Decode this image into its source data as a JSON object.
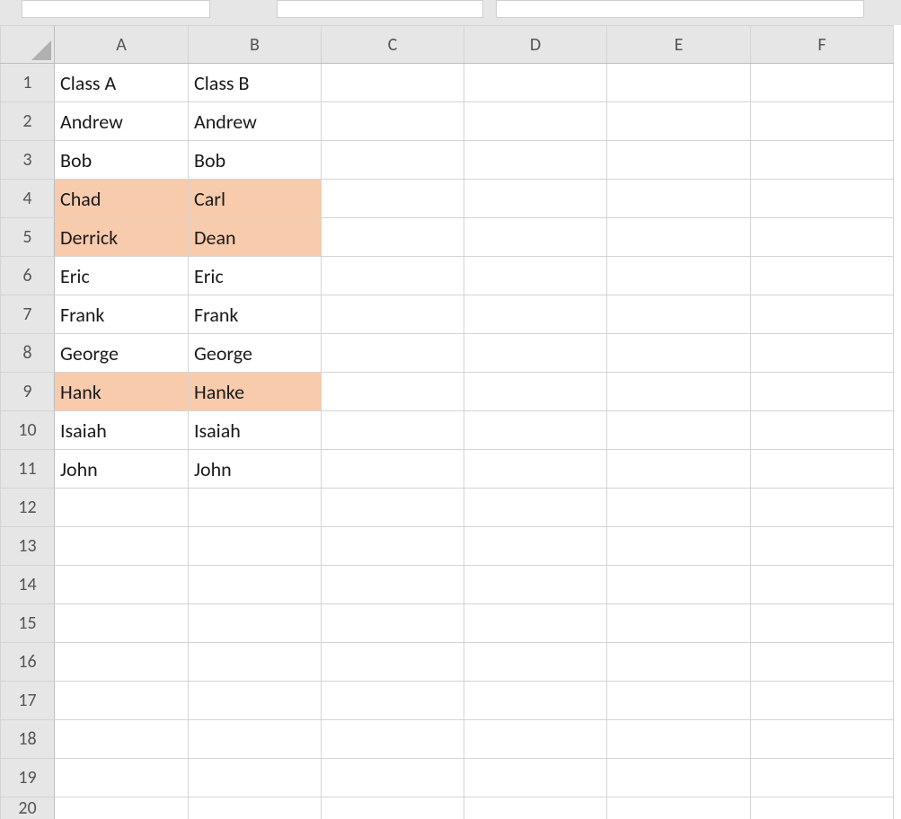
{
  "columns": [
    "A",
    "B",
    "C",
    "D",
    "E",
    "F"
  ],
  "row_numbers": [
    1,
    2,
    3,
    4,
    5,
    6,
    7,
    8,
    9,
    10,
    11,
    12,
    13,
    14,
    15,
    16,
    17,
    18,
    19,
    20
  ],
  "colors": {
    "highlight": "#f8cbad"
  },
  "rows": [
    {
      "a": "Class A",
      "b": "Class B",
      "bold": true
    },
    {
      "a": "Andrew",
      "b": "Andrew"
    },
    {
      "a": "Bob",
      "b": "Bob"
    },
    {
      "a": "Chad",
      "b": "Carl",
      "highlight": true
    },
    {
      "a": "Derrick",
      "b": "Dean",
      "highlight": true
    },
    {
      "a": "Eric",
      "b": "Eric"
    },
    {
      "a": "Frank",
      "b": "Frank"
    },
    {
      "a": "George",
      "b": "George"
    },
    {
      "a": "Hank",
      "b": "Hanke",
      "highlight": true
    },
    {
      "a": "Isaiah",
      "b": "Isaiah"
    },
    {
      "a": "John",
      "b": "John"
    },
    {
      "a": "",
      "b": ""
    },
    {
      "a": "",
      "b": ""
    },
    {
      "a": "",
      "b": ""
    },
    {
      "a": "",
      "b": ""
    },
    {
      "a": "",
      "b": ""
    },
    {
      "a": "",
      "b": ""
    },
    {
      "a": "",
      "b": ""
    },
    {
      "a": "",
      "b": ""
    },
    {
      "a": "",
      "b": ""
    }
  ]
}
